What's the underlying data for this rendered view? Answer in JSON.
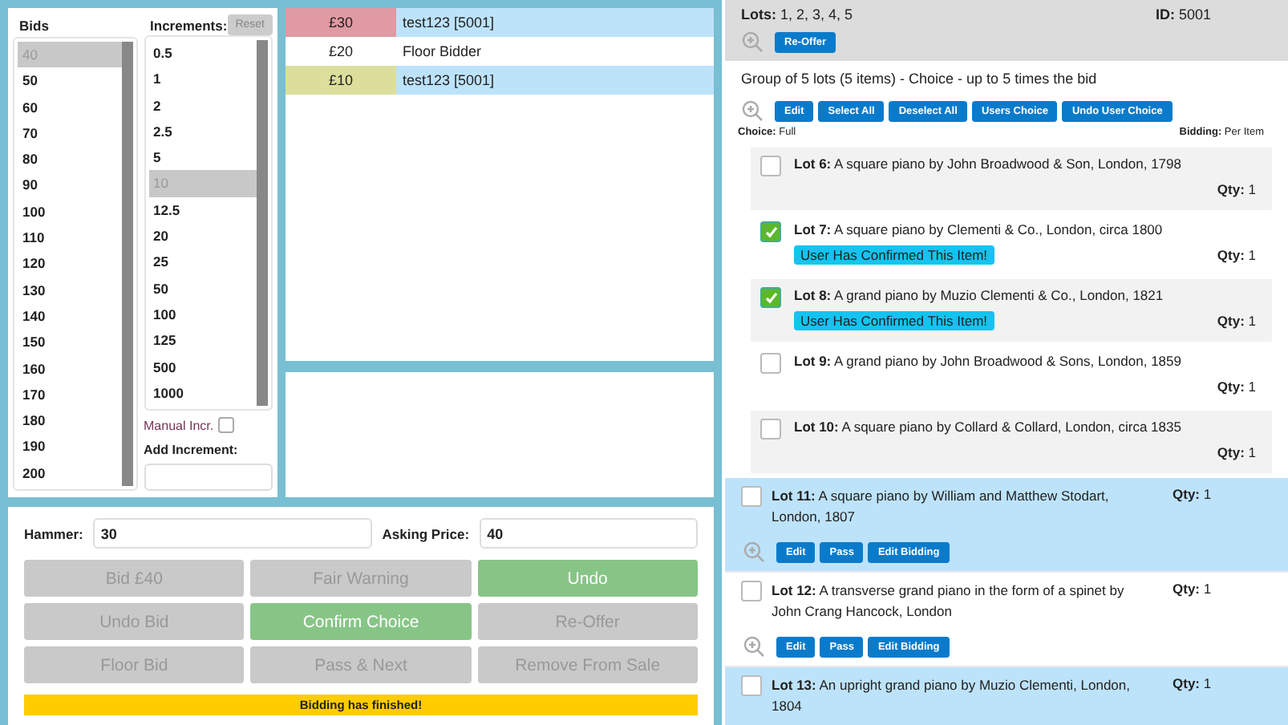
{
  "bids": {
    "label": "Bids",
    "items": [
      {
        "value": "40",
        "selected": true
      },
      {
        "value": "50",
        "selected": false
      },
      {
        "value": "60",
        "selected": false
      },
      {
        "value": "70",
        "selected": false
      },
      {
        "value": "80",
        "selected": false
      },
      {
        "value": "90",
        "selected": false
      },
      {
        "value": "100",
        "selected": false
      },
      {
        "value": "110",
        "selected": false
      },
      {
        "value": "120",
        "selected": false
      },
      {
        "value": "130",
        "selected": false
      },
      {
        "value": "140",
        "selected": false
      },
      {
        "value": "150",
        "selected": false
      },
      {
        "value": "160",
        "selected": false
      },
      {
        "value": "170",
        "selected": false
      },
      {
        "value": "180",
        "selected": false
      },
      {
        "value": "190",
        "selected": false
      },
      {
        "value": "200",
        "selected": false
      }
    ]
  },
  "increments": {
    "label": "Increments:",
    "reset": "Reset",
    "items": [
      {
        "value": "0.5",
        "selected": false
      },
      {
        "value": "1",
        "selected": false
      },
      {
        "value": "2",
        "selected": false
      },
      {
        "value": "2.5",
        "selected": false
      },
      {
        "value": "5",
        "selected": false
      },
      {
        "value": "10",
        "selected": true
      },
      {
        "value": "12.5",
        "selected": false
      },
      {
        "value": "20",
        "selected": false
      },
      {
        "value": "25",
        "selected": false
      },
      {
        "value": "50",
        "selected": false
      },
      {
        "value": "100",
        "selected": false
      },
      {
        "value": "125",
        "selected": false
      },
      {
        "value": "500",
        "selected": false
      },
      {
        "value": "1000",
        "selected": false
      }
    ],
    "manual_label": "Manual Incr.",
    "manual_checked": false,
    "add_label": "Add Increment:"
  },
  "bid_history": [
    {
      "amount": "£30",
      "color": "#e09aa2",
      "bidder": "test123 [5001]",
      "highlighted": true
    },
    {
      "amount": "£20",
      "color": "#ffffff",
      "bidder": "Floor Bidder",
      "highlighted": false
    },
    {
      "amount": "£10",
      "color": "#dcdf9c",
      "bidder": "test123 [5001]",
      "highlighted": true
    }
  ],
  "hammer": {
    "label": "Hammer:",
    "value": "30"
  },
  "asking": {
    "label": "Asking Price:",
    "value": "40"
  },
  "actions": [
    {
      "label": "Bid £40",
      "enabled": false
    },
    {
      "label": "Fair Warning",
      "enabled": false
    },
    {
      "label": "Undo",
      "enabled": true
    },
    {
      "label": "Undo Bid",
      "enabled": false
    },
    {
      "label": "Confirm Choice",
      "enabled": true
    },
    {
      "label": "Re-Offer",
      "enabled": false
    },
    {
      "label": "Floor Bid",
      "enabled": false
    },
    {
      "label": "Pass & Next",
      "enabled": false
    },
    {
      "label": "Remove From Sale",
      "enabled": false
    }
  ],
  "status": "Bidding has finished!",
  "sold_group": {
    "lots": "**Lots:** 1, 2, 3, 4, 5",
    "id": "**ID:** 5001",
    "buttons": [
      "Re-Offer"
    ]
  },
  "choice_group": {
    "title": "Group of 5 lots (5 items) - Choice - up to 5 times the bid",
    "buttons": [
      "Edit",
      "Select All",
      "Deselect All",
      "Users Choice",
      "Undo User Choice"
    ],
    "choice": "**Choice:** Full",
    "bidding": "**Bidding:** Per Item",
    "lots": [
      {
        "text": "**Lot 6:** A square piano by John Broadwood & Son, London, 1798",
        "qty": "**Qty:** 1",
        "checked": false
      },
      {
        "text": "**Lot 7:** A square piano by Clementi & Co., London, circa 1800",
        "qty": "**Qty:** 1",
        "checked": true,
        "badge": "User Has Confirmed This Item!"
      },
      {
        "text": "**Lot 8:** A grand piano by Muzio Clementi & Co., London, 1821",
        "qty": "**Qty:** 1",
        "checked": true,
        "badge": "User Has Confirmed This Item!"
      },
      {
        "text": "**Lot 9:** A grand piano by John Broadwood & Sons, London, 1859",
        "qty": "**Qty:** 1",
        "checked": false
      },
      {
        "text": "**Lot 10:** A square piano by Collard & Collard, London, circa 1835",
        "qty": "**Qty:** 1",
        "checked": false
      }
    ]
  },
  "lots": [
    {
      "text": "**Lot 11:** A square piano by William and Matthew Stodart, London, 1807",
      "qty": "**Qty:** 1",
      "checked": false,
      "highlighted": true,
      "buttons": [
        "Edit",
        "Pass",
        "Edit Bidding"
      ]
    },
    {
      "text": "**Lot 12:** A transverse grand piano in the form of a spinet by John Crang Hancock, London",
      "qty": "**Qty:** 1",
      "checked": false,
      "highlighted": false,
      "buttons": [
        "Edit",
        "Pass",
        "Edit Bidding"
      ]
    },
    {
      "text": "**Lot 13:** An upright grand piano by Muzio Clementi, London, 1804",
      "qty": "**Qty:** 1",
      "checked": false,
      "highlighted": true
    }
  ]
}
